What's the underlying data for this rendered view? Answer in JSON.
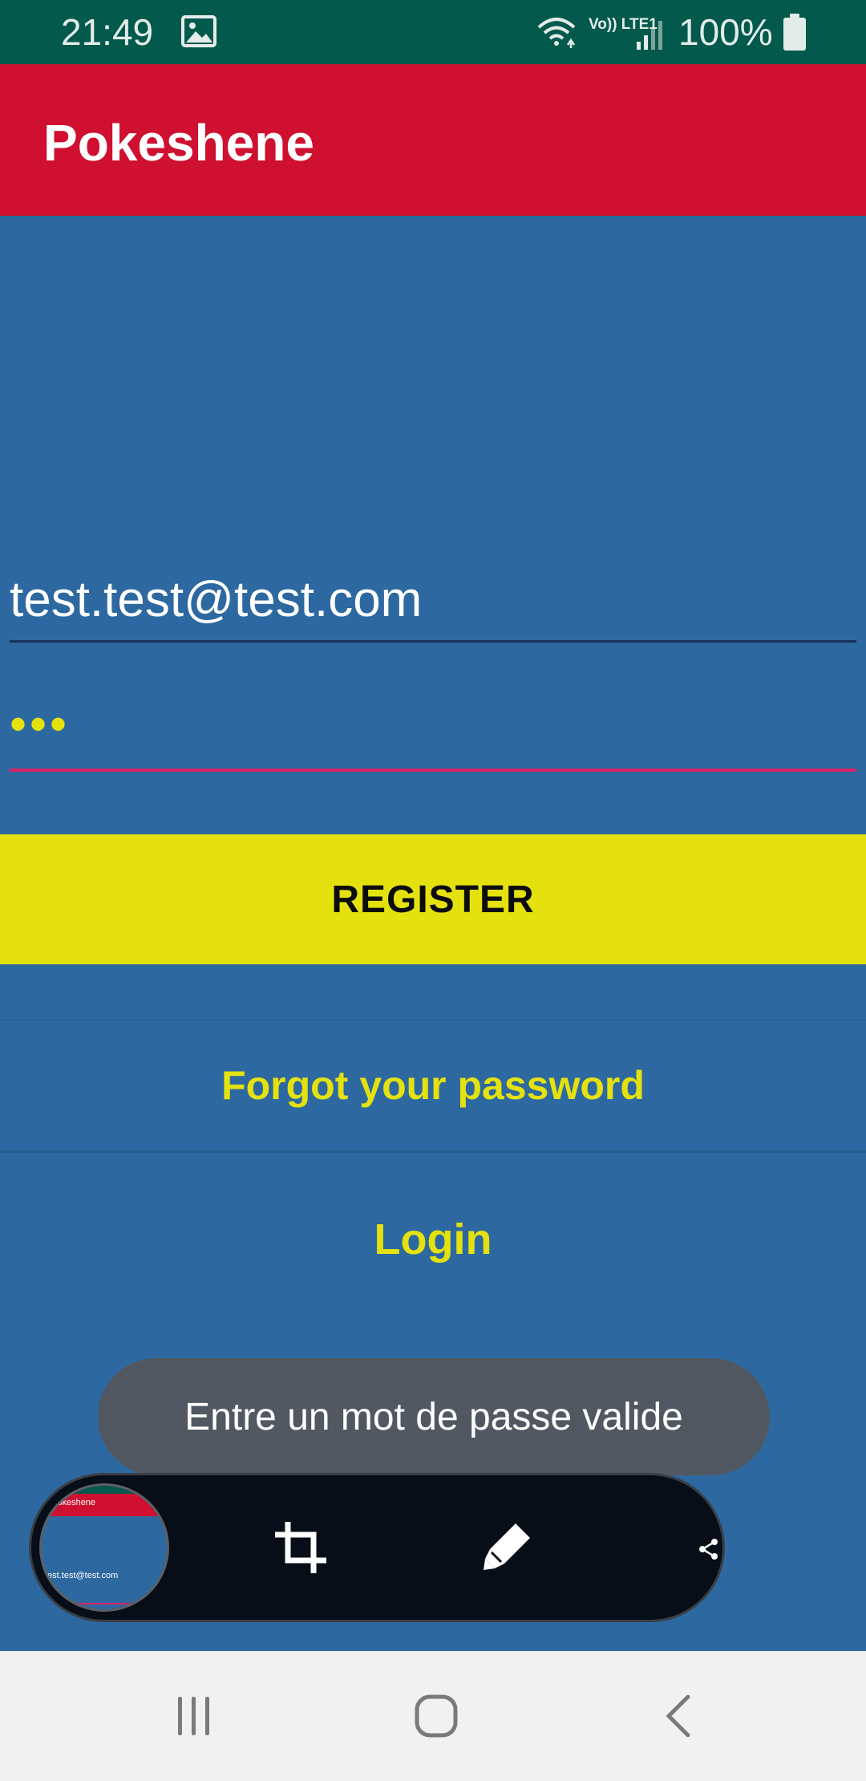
{
  "status_bar": {
    "time": "21:49",
    "network": "Vo)) LTE1",
    "battery": "100%",
    "icons": [
      "gallery-icon",
      "wifi-icon",
      "volte-icon",
      "signal-icon",
      "battery-icon"
    ]
  },
  "app_bar": {
    "title": "Pokeshene",
    "color": "#cf1030"
  },
  "form": {
    "email_value": "test.test@test.com",
    "password_value": "•••",
    "register_label": "REGISTER",
    "forgot_label": "Forgot your password",
    "login_label": "Login"
  },
  "toast": {
    "message": "Entre un mot de passe valide"
  },
  "capture_toolbar": {
    "thumbnail_title": "Pokeshene",
    "thumbnail_email": "test.test@test.com",
    "icons": [
      "crop-icon",
      "edit-pen-icon",
      "share-icon"
    ]
  },
  "nav_bar": {
    "icons": [
      "recent-apps-icon",
      "home-icon",
      "back-icon"
    ]
  },
  "colors": {
    "background": "#2d69a0",
    "accent": "#e4e10e",
    "status_bar": "#03594b",
    "error_underline": "#d8236a"
  }
}
